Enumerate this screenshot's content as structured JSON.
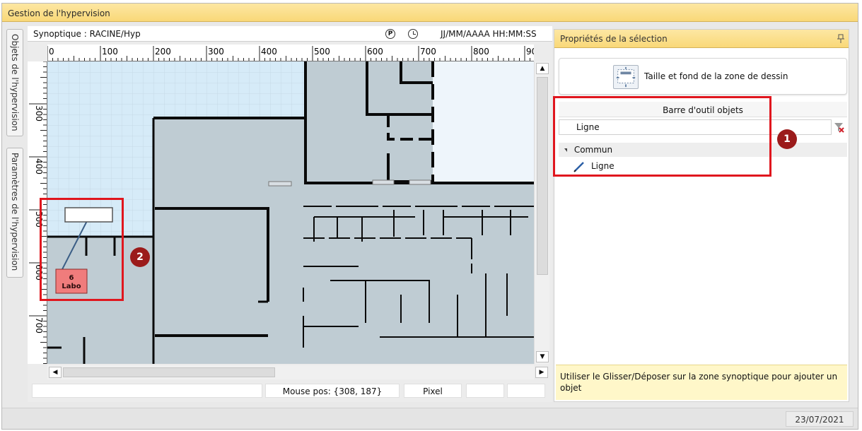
{
  "window": {
    "title": "Gestion de l'hypervision"
  },
  "left_tabs": [
    "Objets de l'hypervision",
    "Paramètres de l'hypervision"
  ],
  "synoptique": {
    "title": "Synoptique : RACINE/Hyp",
    "p_icon": "P",
    "datetime": "JJ/MM/AAAA HH:MM:SS",
    "ruler_h": [
      "0",
      "100",
      "200",
      "300",
      "400",
      "500",
      "600",
      "700",
      "800",
      "90"
    ],
    "ruler_v": [
      "300",
      "400",
      "500",
      "600",
      "700"
    ],
    "room_label_number": "6",
    "room_label_name": "Labo"
  },
  "statusbar": {
    "mouse_pos": "Mouse pos: {308, 187}",
    "unit": "Pixel"
  },
  "properties": {
    "title": "Propriétés de la sélection",
    "size_button": "Taille et fond de la zone de dessin",
    "toolbar_title": "Barre d'outil objets",
    "filter_value": "Ligne",
    "group": "Commun",
    "item": "Ligne",
    "hint": "Utiliser le Glisser/Déposer sur la zone synoptique pour ajouter un objet"
  },
  "badges": [
    "1",
    "2"
  ],
  "footer": {
    "date": "23/07/2021"
  },
  "colors": {
    "accent": "#f9d878",
    "highlight": "#e0161e",
    "badge": "#9b1b1b",
    "room": "#bfccd3",
    "label_room": "#f07c7c"
  },
  "icons": [
    "pin-icon",
    "size-icon",
    "clear-filter-icon",
    "pen-icon",
    "clock-icon",
    "p-icon"
  ]
}
